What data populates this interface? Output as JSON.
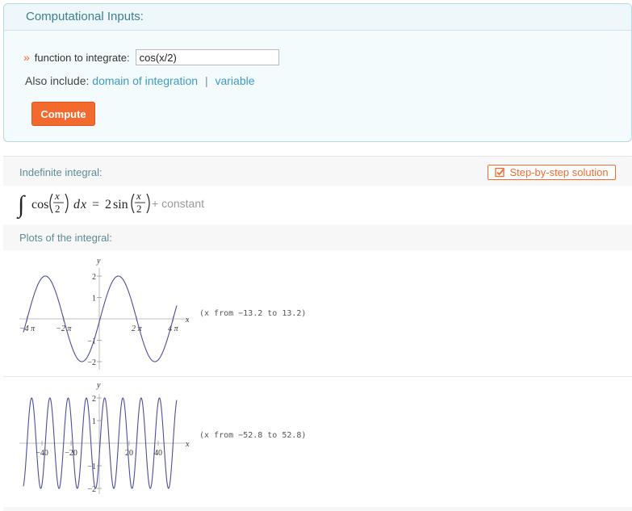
{
  "inputs": {
    "title": "Computational Inputs:",
    "chevron": "»",
    "function_label": "function to integrate:",
    "function_value": "cos(x/2)",
    "also_include": "Also include:",
    "link_domain": "domain of integration",
    "separator": "|",
    "link_variable": "variable",
    "compute_label": "Compute"
  },
  "indefinite": {
    "title": "Indefinite integral:",
    "step_button": "Step-by-step solution",
    "formula": {
      "integral_sign": "∫",
      "cos": "cos",
      "x": "x",
      "two": "2",
      "d": "d",
      "equals": "=",
      "sin_coef": "2",
      "sin": "sin",
      "constant": "+ constant"
    }
  },
  "plots": {
    "title": "Plots of the integral:",
    "plot1": {
      "y_axis_label": "y",
      "x_axis_label": "x",
      "y_ticks": [
        "2",
        "1",
        "−1",
        "−2"
      ],
      "x_ticks": [
        "−4 π",
        "−2 π",
        "2 π",
        "4 π"
      ],
      "range_note": "(x from −13.2 to 13.2)"
    },
    "plot2": {
      "y_axis_label": "y",
      "x_axis_label": "x",
      "y_ticks": [
        "2",
        "1",
        "−1",
        "−2"
      ],
      "x_ticks": [
        "−40",
        "−20",
        "20",
        "40"
      ],
      "range_note": "(x from −52.8 to 52.8)"
    }
  },
  "chart_data": [
    {
      "type": "line",
      "function": "2 sin(x/2)",
      "xlim": [
        -13.2,
        13.2
      ],
      "ylim": [
        -2,
        2
      ],
      "xlabel": "x",
      "ylabel": "y",
      "x_ticks": [
        "−4 π",
        "−2 π",
        "2 π",
        "4 π"
      ],
      "y_ticks": [
        2,
        1,
        -1,
        -2
      ],
      "color": "#4d4d9b",
      "grid": false
    },
    {
      "type": "line",
      "function": "2 sin(x/2)",
      "xlim": [
        -52.8,
        52.8
      ],
      "ylim": [
        -2,
        2
      ],
      "xlabel": "x",
      "ylabel": "y",
      "x_ticks": [
        -40,
        -20,
        20,
        40
      ],
      "y_ticks": [
        2,
        1,
        -1,
        -2
      ],
      "color": "#4d4d9b",
      "grid": false
    }
  ],
  "colors": {
    "accent": "#f26b2e",
    "link": "#3d9bc4",
    "header_text": "#3f7f8f",
    "curve": "#4d4d9b"
  }
}
